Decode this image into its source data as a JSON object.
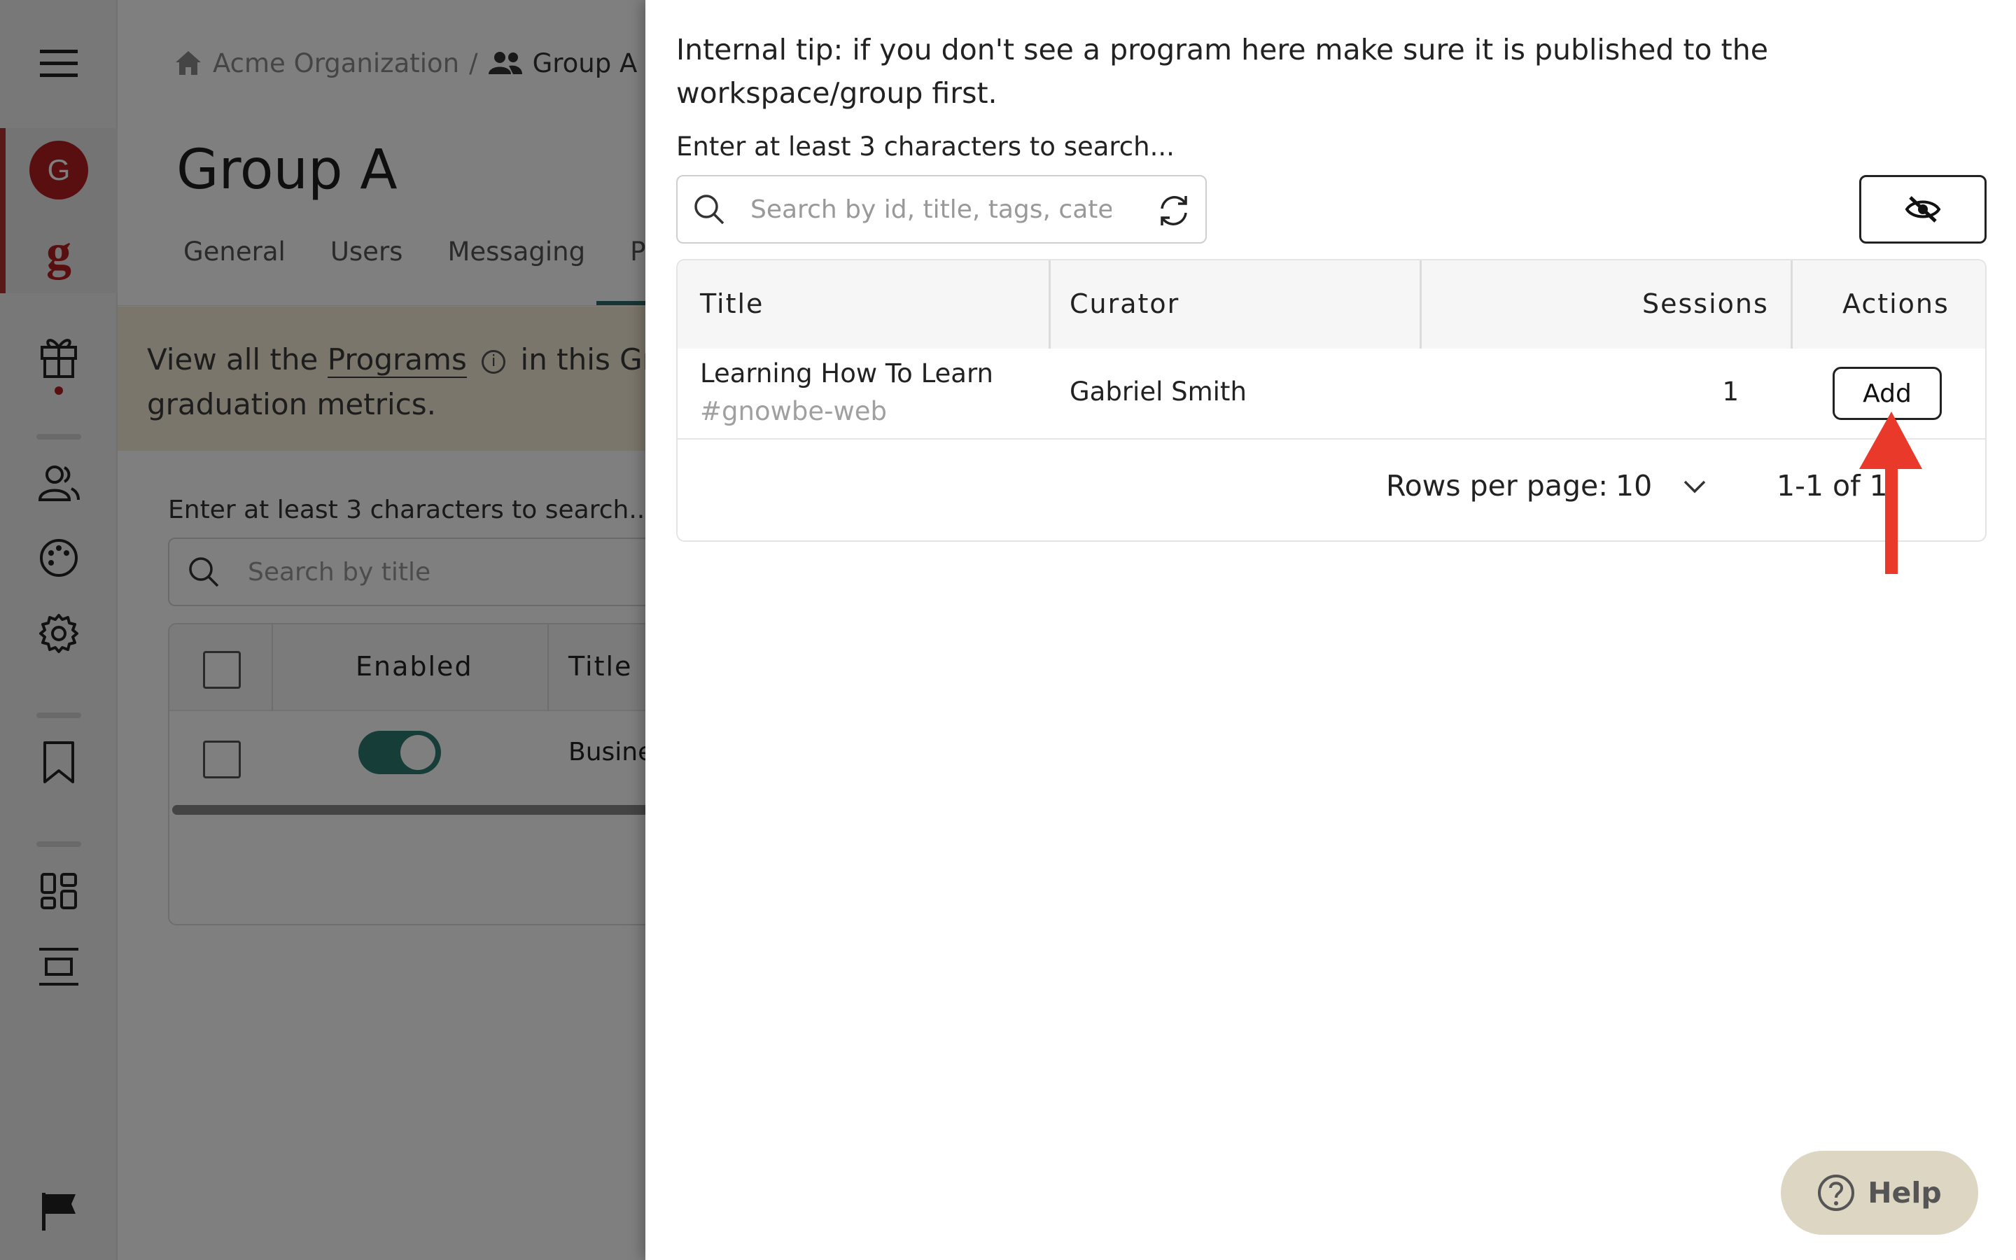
{
  "sidebar": {
    "avatar_initial": "G",
    "logo_letter": "g",
    "icons": [
      "menu-icon",
      "avatar",
      "logo",
      "gift-icon",
      "users-icon",
      "palette-icon",
      "gear-icon",
      "bookmark-icon",
      "dashboard-icon",
      "layout-icon",
      "flag-icon"
    ],
    "accent_color": "#b21f1f"
  },
  "breadcrumb": {
    "org": "Acme Organization",
    "separator": "/",
    "group": "Group A"
  },
  "page": {
    "title": "Group A",
    "tabs": [
      "General",
      "Users",
      "Messaging",
      "Pro"
    ],
    "banner_prefix": "View all the",
    "banner_link": "Programs",
    "banner_info": "i",
    "banner_suffix": "in this Group",
    "banner_line2": "graduation metrics.",
    "search_hint": "Enter at least 3 characters to search...",
    "search_placeholder": "Search by title",
    "table_headers": [
      "Enabled",
      "Title"
    ],
    "row_title_fragment": "Busine",
    "toggle_enabled": true
  },
  "drawer": {
    "tip": "Internal tip: if you don't see a program here make sure it is published to the workspace/group first.",
    "search_hint": "Enter at least 3 characters to search...",
    "search_placeholder": "Search by id, title, tags, categories",
    "search_value": "",
    "table": {
      "headers": [
        "Title",
        "Curator",
        "Sessions",
        "Actions"
      ],
      "rows": [
        {
          "title": "Learning How To Learn",
          "tag": "#gnowbe-web",
          "curator": "Gabriel Smith",
          "sessions": "1",
          "action": "Add"
        }
      ],
      "rows_per_page_label": "Rows per page:",
      "rows_per_page": "10",
      "range": "1-1 of 1"
    }
  },
  "help": {
    "label": "Help"
  },
  "colors": {
    "arrow": "#e8392a",
    "help_bg": "#dcd6c2",
    "banner_bg": "#f6ecd6",
    "toggle": "#2f7a73"
  }
}
